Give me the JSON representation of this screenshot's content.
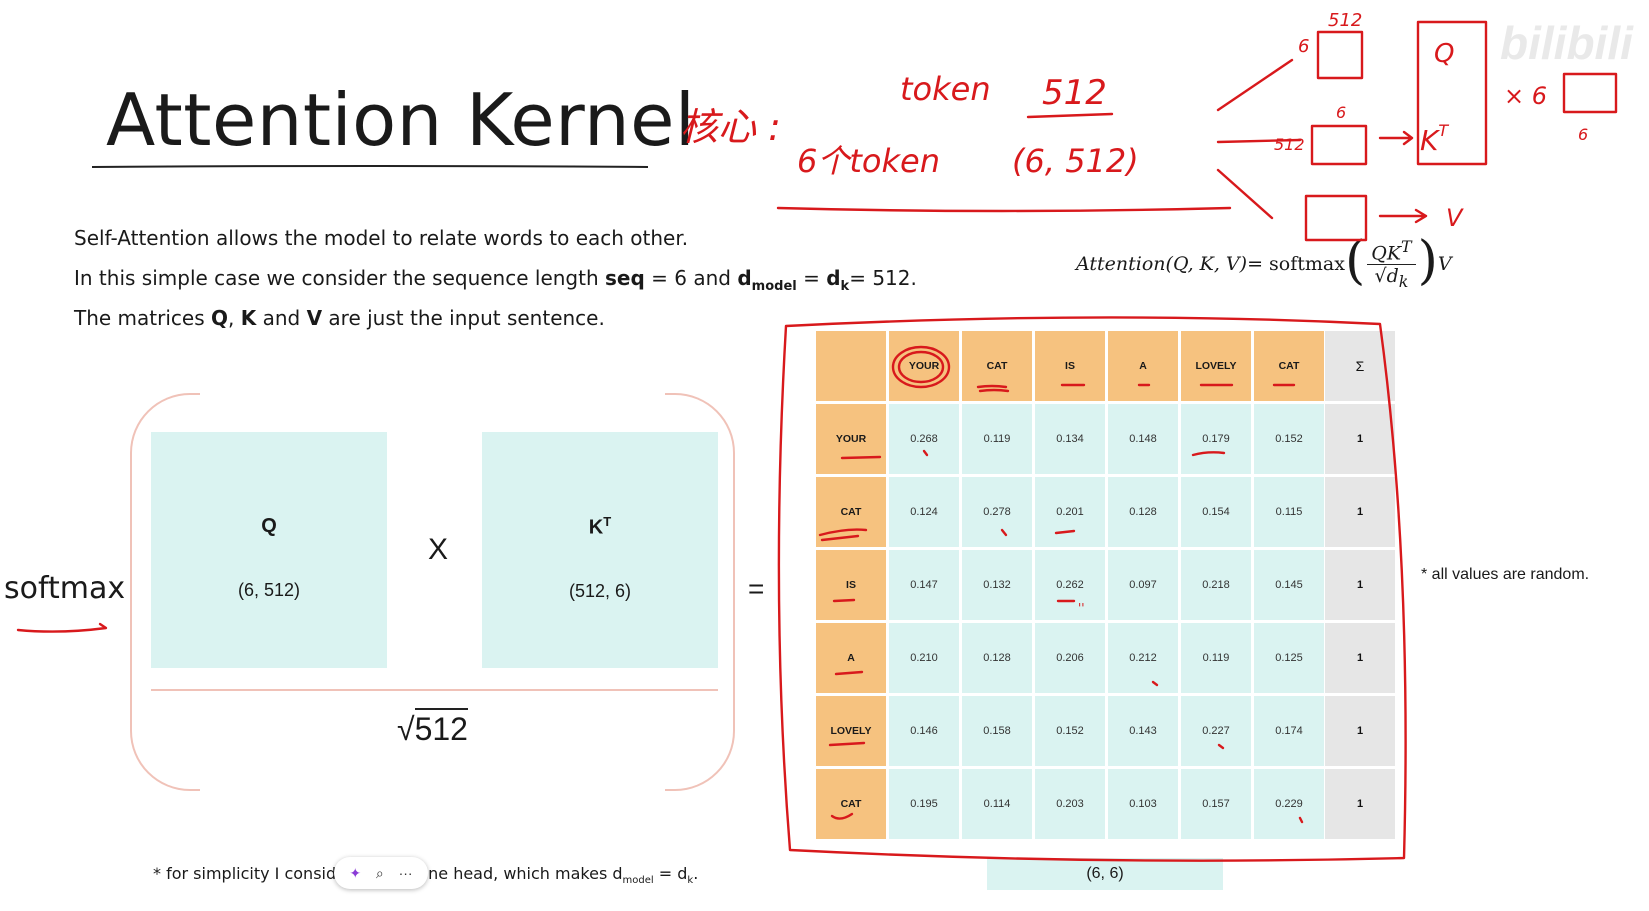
{
  "slide": {
    "title": "Attention Kernel",
    "line1": "Self-Attention allows the model to relate words to each other.",
    "line2_a": "In this simple case we consider the sequence length ",
    "line2_seq": "seq",
    "line2_b": " = 6 and ",
    "line2_d": "d",
    "line2_model": "model",
    "line2_c": " = ",
    "line2_dk": "d",
    "line2_k": "k",
    "line2_e": "= 512.",
    "line3_a": "The matrices ",
    "line3_q": "Q",
    "line3_b": ", ",
    "line3_k": "K",
    "line3_c": " and ",
    "line3_v": "V",
    "line3_d": " are just the input sentence.",
    "formula": {
      "lhs": "Attention(Q, K, V)",
      "eq": " = softmax",
      "num": "QK",
      "num_sup": "T",
      "den": "√d",
      "den_sub": "k",
      "tail": "V"
    },
    "softmax_label": "softmax",
    "matrix_q": {
      "name": "Q",
      "shape": "(6, 512)"
    },
    "matrix_k": {
      "name": "K",
      "name_sup": "T",
      "shape": "(512, 6)"
    },
    "times": "X",
    "sqrt_sign": "√",
    "sqrt_value": "512",
    "equals": "=",
    "result_shape": "(6, 6)",
    "note_random": "* all values are random.",
    "footnote_a": "* for simplicity I consid",
    "footnote_b": "ne head, which makes d",
    "footnote_model": "model",
    "footnote_c": " = d",
    "footnote_k": "k",
    "footnote_d": ".",
    "watermark": "bilibili"
  },
  "popup": {
    "spark": "✦",
    "search": "⌕",
    "more": "···"
  },
  "attention_table": {
    "columns": [
      "YOUR",
      "CAT",
      "IS",
      "A",
      "LOVELY",
      "CAT"
    ],
    "sum_header": "Σ",
    "rows": [
      {
        "label": "YOUR",
        "values": [
          "0.268",
          "0.119",
          "0.134",
          "0.148",
          "0.179",
          "0.152"
        ],
        "sum": "1"
      },
      {
        "label": "CAT",
        "values": [
          "0.124",
          "0.278",
          "0.201",
          "0.128",
          "0.154",
          "0.115"
        ],
        "sum": "1"
      },
      {
        "label": "IS",
        "values": [
          "0.147",
          "0.132",
          "0.262",
          "0.097",
          "0.218",
          "0.145"
        ],
        "sum": "1"
      },
      {
        "label": "A",
        "values": [
          "0.210",
          "0.128",
          "0.206",
          "0.212",
          "0.119",
          "0.125"
        ],
        "sum": "1"
      },
      {
        "label": "LOVELY",
        "values": [
          "0.146",
          "0.158",
          "0.152",
          "0.143",
          "0.227",
          "0.174"
        ],
        "sum": "1"
      },
      {
        "label": "CAT",
        "values": [
          "0.195",
          "0.114",
          "0.203",
          "0.103",
          "0.157",
          "0.229"
        ],
        "sum": "1"
      }
    ]
  },
  "handwriting": {
    "core": "核心 :",
    "token": "token",
    "dim512": "512",
    "six_tokens": "6个token",
    "shape": "(6, 512)",
    "top_512": "512",
    "top_6": "6",
    "q": "Q",
    "mid_6": "6",
    "mid_512": "512",
    "kt": "K",
    "kt_sup": "T",
    "v": "V",
    "times6": "× 6",
    "small_6": "6",
    "tick": "''"
  },
  "colors": {
    "header": "#f6c27f",
    "cell": "#daf3f1",
    "sum": "#e6e6e6",
    "ink": "#d8191c",
    "bracket": "#f0c2b8"
  }
}
